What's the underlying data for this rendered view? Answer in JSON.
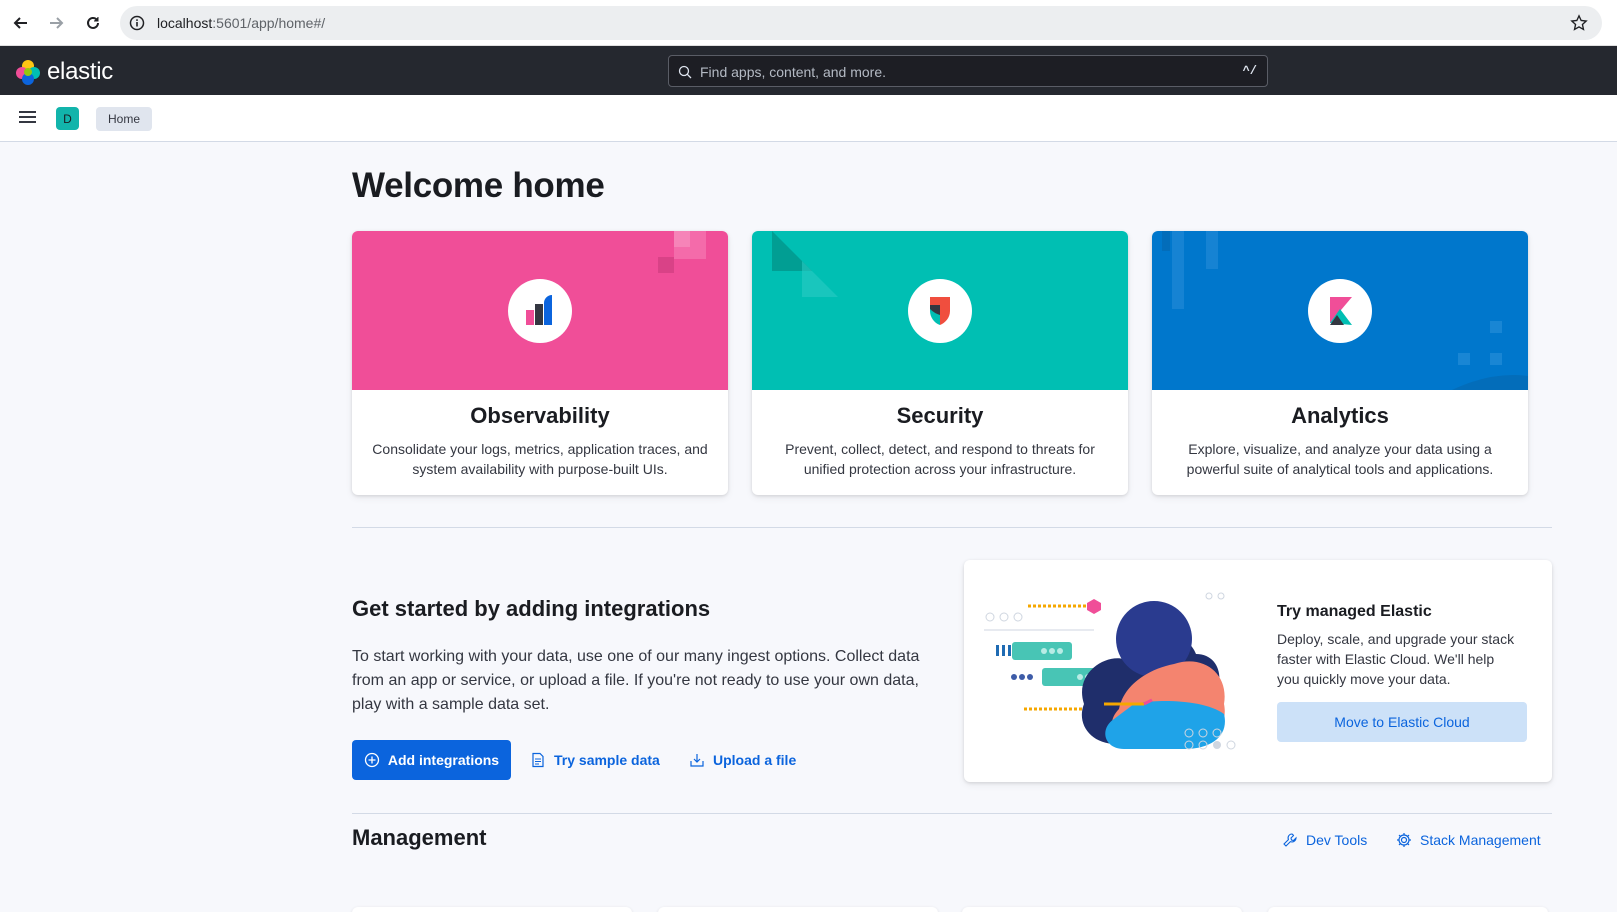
{
  "browser": {
    "url_host": "localhost",
    "url_path": ":5601/app/home#/"
  },
  "header": {
    "logo_text": "elastic",
    "search_placeholder": "Find apps, content, and more.",
    "search_shortcut": "^/"
  },
  "subheader": {
    "space_initial": "D",
    "breadcrumb": "Home"
  },
  "page": {
    "title": "Welcome home"
  },
  "solutions": [
    {
      "title": "Observability",
      "description": "Consolidate your logs, metrics, application traces, and system availability with purpose-built UIs.",
      "color": "#f04e98"
    },
    {
      "title": "Security",
      "description": "Prevent, collect, detect, and respond to threats for unified protection across your infrastructure.",
      "color": "#00bfb3"
    },
    {
      "title": "Analytics",
      "description": "Explore, visualize, and analyze your data using a powerful suite of analytical tools and applications.",
      "color": "#0077cc"
    }
  ],
  "get_started": {
    "title": "Get started by adding integrations",
    "text": "To start working with your data, use one of our many ingest options. Collect data from an app or service, or upload a file. If you're not ready to use your own data, play with a sample data set.",
    "add_integrations": "Add integrations",
    "try_sample": "Try sample data",
    "upload_file": "Upload a file"
  },
  "cloud": {
    "title": "Try managed Elastic",
    "text": "Deploy, scale, and upgrade your stack faster with Elastic Cloud. We'll help you quickly move your data.",
    "button": "Move to Elastic Cloud"
  },
  "management": {
    "title": "Management",
    "dev_tools": "Dev Tools",
    "stack_management": "Stack Management"
  }
}
